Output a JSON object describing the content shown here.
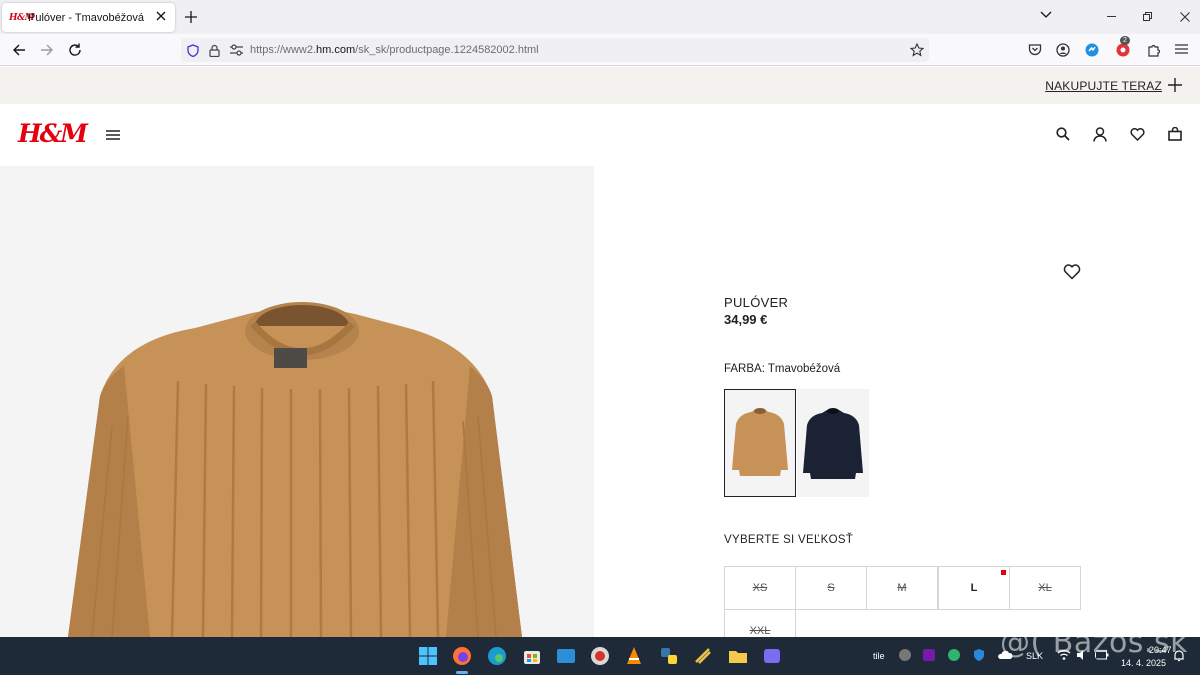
{
  "browser": {
    "tab_title": "Pulóver - Tmavobéžová",
    "tab_favicon_text": "H&M",
    "url_prefix": "https://www2.",
    "url_domain": "hm.com",
    "url_path": "/sk_sk/productpage.1224582002.html",
    "extension_badge": "2"
  },
  "site": {
    "logo": "H&M",
    "promo_link": "NAKUPUJTE TERAZ"
  },
  "product": {
    "name": "PULÓVER",
    "price": "34,99 €",
    "color_label": "FARBA: Tmavobéžová",
    "swatches": [
      {
        "color_name": "Tmavobéžová",
        "color": "#c69258",
        "selected": true
      },
      {
        "color_name": "Tmavomodrá",
        "color": "#1b2233",
        "selected": false
      }
    ],
    "size_label": "VYBERTE SI VEĽKOSŤ",
    "sizes": [
      {
        "label": "XS",
        "available": false
      },
      {
        "label": "S",
        "available": false
      },
      {
        "label": "M",
        "available": false
      },
      {
        "label": "L",
        "available": true,
        "low_stock": true
      },
      {
        "label": "XL",
        "available": false
      },
      {
        "label": "XXL",
        "available": false
      }
    ]
  },
  "colors": {
    "brand_red": "#e50010",
    "sweater": "#c69258",
    "taskbar": "#1e2a37"
  },
  "taskbar": {
    "tray_tile": "tile",
    "language": "SLK",
    "time": "20:47",
    "date": "14. 4. 2025"
  },
  "watermark": "@( Bazos.sk"
}
